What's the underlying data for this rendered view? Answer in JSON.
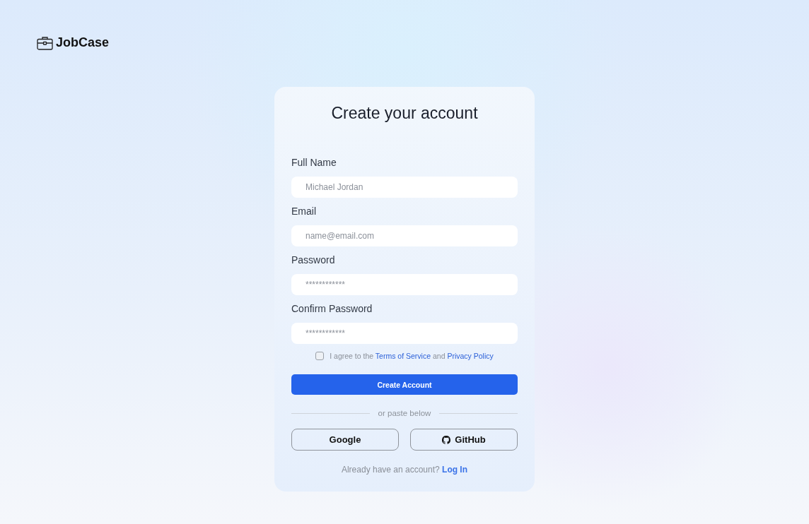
{
  "brand": {
    "name": "JobCase"
  },
  "form": {
    "title": "Create your account",
    "fields": [
      {
        "label": "Full Name",
        "placeholder": "Michael Jordan"
      },
      {
        "label": "Email",
        "placeholder": "name@email.com"
      },
      {
        "label": "Password",
        "placeholder": "************"
      },
      {
        "label": "Confirm Password",
        "placeholder": "************"
      }
    ],
    "agreement": {
      "checked": false,
      "parts": [
        {
          "kind": "text",
          "text": "I agree to the"
        },
        {
          "kind": "link",
          "text": "Terms of Service"
        },
        {
          "kind": "text",
          "text": "and"
        },
        {
          "kind": "link",
          "text": "Privacy Policy"
        }
      ]
    },
    "submit": "Create Account",
    "divider": "or paste below",
    "social": [
      {
        "kind": "google",
        "label": "Google"
      },
      {
        "kind": "github",
        "label": "GitHub"
      }
    ],
    "footer": {
      "text": "Already have an account?",
      "link": "Log In"
    }
  }
}
